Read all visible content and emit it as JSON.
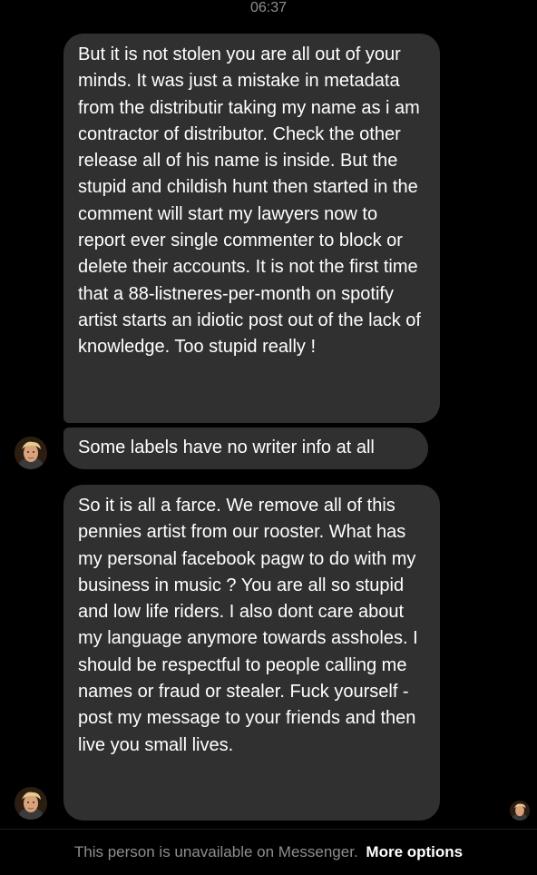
{
  "status_time": "06:37",
  "messages": [
    {
      "sender": "self",
      "text": "But it is not stolen you are all out of your minds. It was just a mistake in metadata from the distributir taking my name as i am contractor of distributor. Check the other release all of his name is inside. But the stupid and childish hunt then started in the comment will start my lawyers now to report ever single commenter to block or delete their accounts. It is not the first time that a 88-listneres-per-month on spotify artist starts an idiotic post out of the lack of knowledge. Too stupid really !"
    },
    {
      "sender": "other",
      "text": "Some labels have no writer info at all"
    },
    {
      "sender": "other",
      "text": "So it is all a farce. We remove all of this pennies artist from our rooster. What has my personal facebook pagw to do with my business in music ? You are all so stupid and low life riders. I also dont care about my language anymore towards assholes. I should be respectful to people calling me names or fraud or stealer. Fuck yourself - post my message to your friends and then live you small lives."
    }
  ],
  "footer": {
    "notice": "This person is unavailable on Messenger.",
    "more_options": "More options"
  },
  "colors": {
    "background": "#000000",
    "bubble": "#303030",
    "text": "#ffffff",
    "muted": "#8e8e93"
  },
  "icons": {
    "avatar": "contact-avatar",
    "seen_indicator": "seen-avatar-icon"
  }
}
